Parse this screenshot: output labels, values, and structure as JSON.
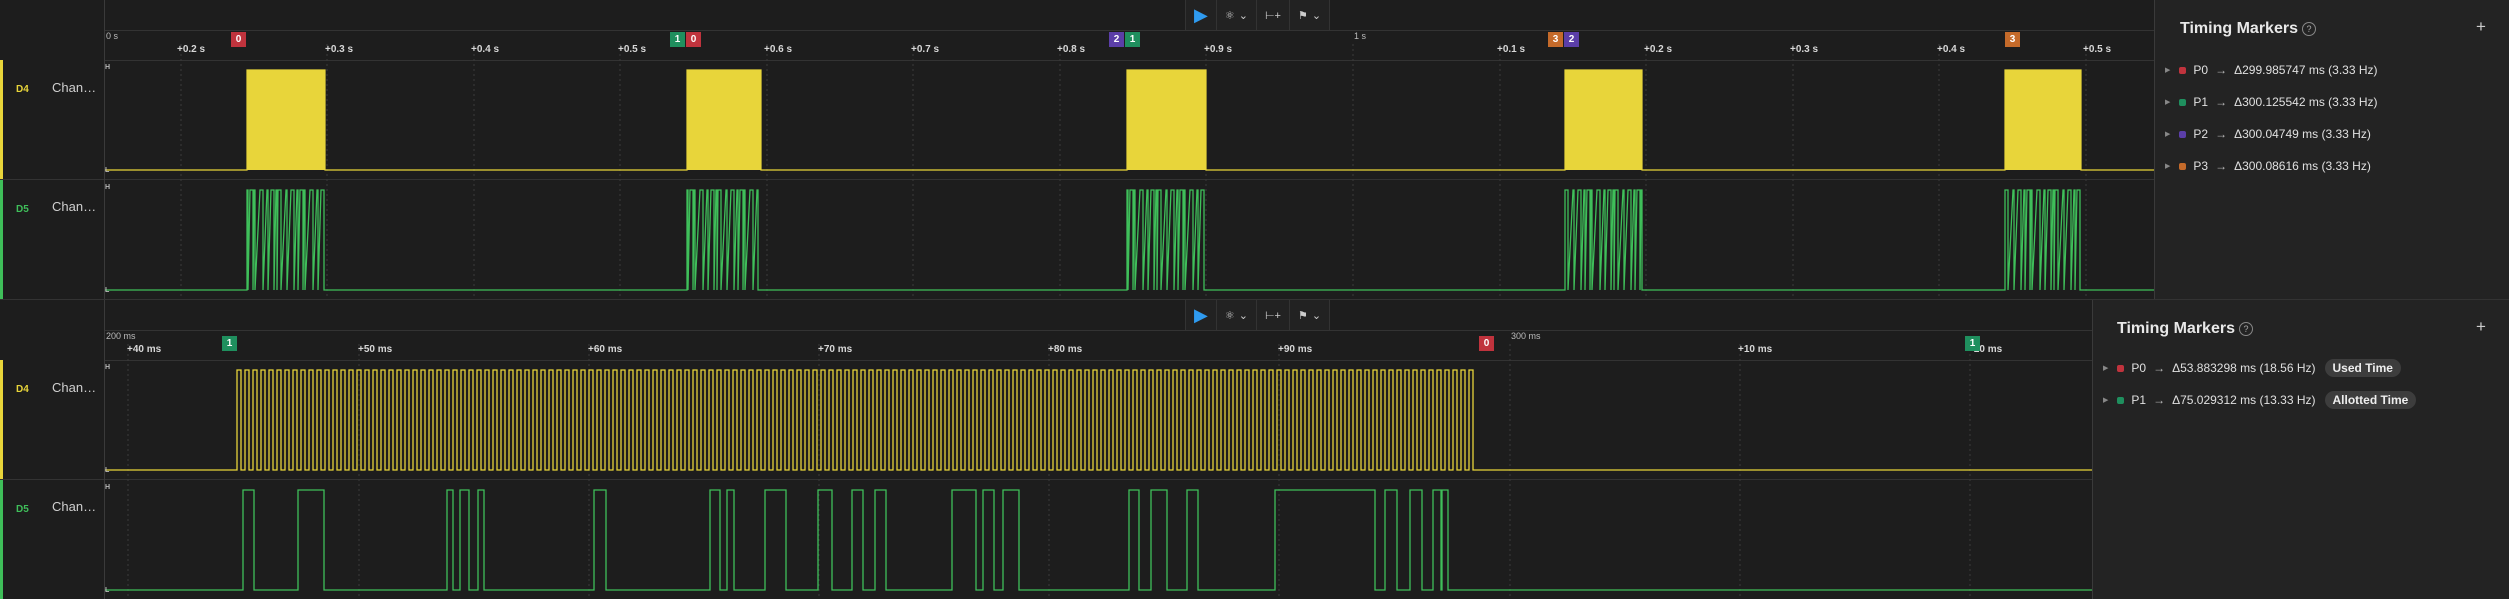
{
  "colors": {
    "d4": "#e8d53a",
    "d5": "#3fbf5a",
    "m0": "#c0333d",
    "m1": "#1f8f5e",
    "m2": "#5b3ea8",
    "m3": "#c46a2a",
    "play": "#2f9bf0"
  },
  "toolbar": {
    "play_icon": "play-icon",
    "trigger_icon": "trigger-icon",
    "measure_icon": "measure-icon",
    "marker_icon": "marker-icon",
    "dropdown_glyph": "⌄"
  },
  "channels": [
    {
      "id": "D4",
      "name": "Chan…",
      "high": "H",
      "low": "L"
    },
    {
      "id": "D5",
      "name": "Chan…",
      "high": "H",
      "low": "L"
    }
  ],
  "panel1": {
    "base_left": "0 s",
    "base_mid": "1 s",
    "ticks": [
      "+0.2 s",
      "+0.3 s",
      "+0.4 s",
      "+0.5 s",
      "+0.6 s",
      "+0.7 s",
      "+0.8 s",
      "+0.9 s",
      "+0.1 s",
      "+0.2 s",
      "+0.3 s",
      "+0.4 s",
      "+0.5 s"
    ],
    "flags": [
      "0",
      "1",
      "0",
      "2",
      "1",
      "3",
      "2",
      "3"
    ],
    "sidebar": {
      "title": "Timing Markers",
      "help": "?",
      "add": "+",
      "markers": [
        {
          "name": "P0",
          "delta": "Δ299.985747 ms (3.33 Hz)"
        },
        {
          "name": "P1",
          "delta": "Δ300.125542 ms (3.33 Hz)"
        },
        {
          "name": "P2",
          "delta": "Δ300.04749 ms (3.33 Hz)"
        },
        {
          "name": "P3",
          "delta": "Δ300.08616 ms (3.33 Hz)"
        }
      ]
    }
  },
  "panel2": {
    "base_left": "200 ms",
    "base_mid": "300 ms",
    "ticks": [
      "+40 ms",
      "+50 ms",
      "+60 ms",
      "+70 ms",
      "+80 ms",
      "+90 ms",
      "+10 ms",
      "+20 ms"
    ],
    "flags": [
      "1",
      "0",
      "1"
    ],
    "sidebar": {
      "title": "Timing Markers",
      "help": "?",
      "add": "+",
      "markers": [
        {
          "name": "P0",
          "delta": "Δ53.883298 ms (18.56 Hz)",
          "badge": "Used Time"
        },
        {
          "name": "P1",
          "delta": "Δ75.029312 ms (13.33 Hz)",
          "badge": "Allotted Time"
        }
      ]
    }
  }
}
